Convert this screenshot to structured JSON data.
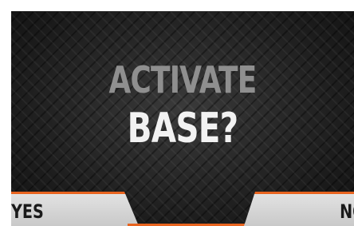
{
  "dialog": {
    "title_line1": "ACTIVATE",
    "title_line2": "BASE?"
  },
  "buttons": {
    "yes_label": "YES",
    "no_label": "NO"
  },
  "colors": {
    "accent": "#e8641f",
    "button_bg": "#d6d6d6",
    "title_dim": "#8f8f8f",
    "title_bright": "#f2f2f2"
  }
}
